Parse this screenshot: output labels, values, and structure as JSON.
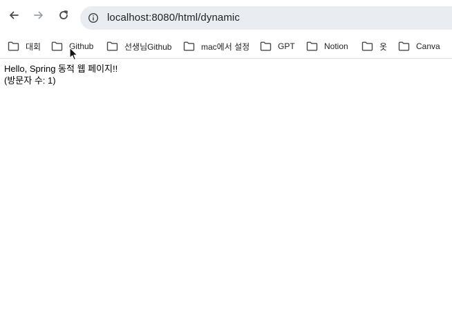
{
  "browser": {
    "url": "localhost:8080/html/dynamic",
    "nav_icons": {
      "back": "arrow-left-icon",
      "forward": "arrow-right-icon",
      "reload": "reload-icon",
      "site_info": "info-icon"
    },
    "colors": {
      "omnibox_bg": "#e9edf2",
      "forward_disabled": "#9aa0a6",
      "icon": "#474747"
    }
  },
  "bookmarks": [
    {
      "label": "대회",
      "icon": "folder-icon"
    },
    {
      "label": "Github",
      "icon": "folder-icon"
    },
    {
      "label": "선생님Github",
      "icon": "folder-icon"
    },
    {
      "label": "mac에서 설정",
      "icon": "folder-icon"
    },
    {
      "label": "GPT",
      "icon": "folder-icon"
    },
    {
      "label": "Notion",
      "icon": "folder-icon"
    },
    {
      "label": "옷",
      "icon": "folder-icon"
    },
    {
      "label": "Canva",
      "icon": "folder-icon"
    }
  ],
  "page": {
    "greeting": "Hello, Spring 동적 웹 페이지!!",
    "visitor_count": "(방문자 수: 1)"
  }
}
